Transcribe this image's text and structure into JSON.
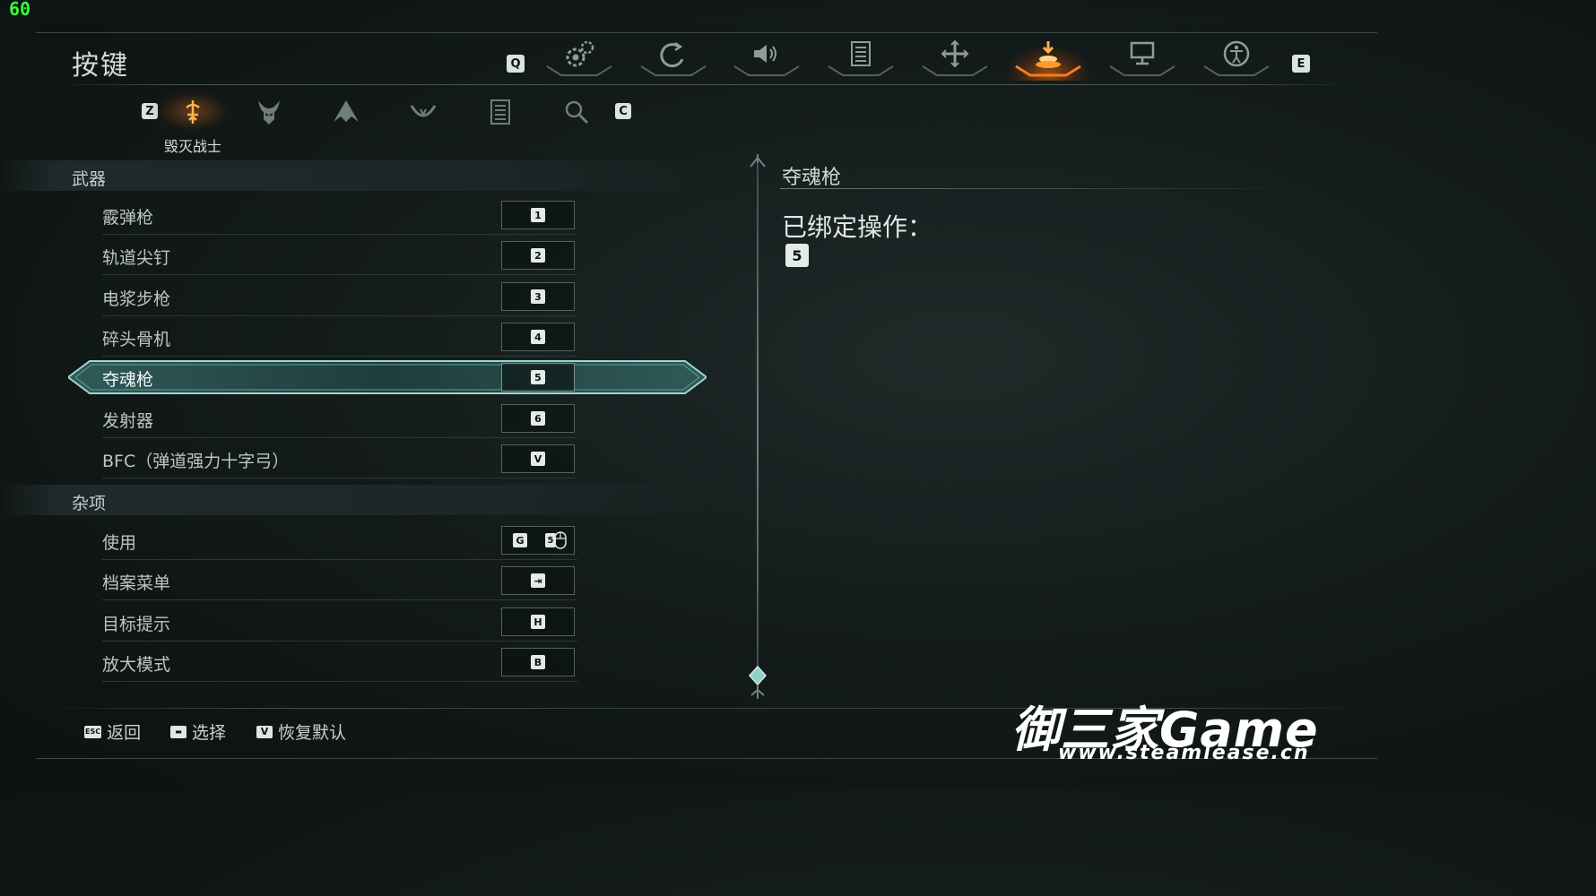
{
  "fps": "60",
  "page_title": "按键",
  "top_nav": {
    "left_key": "Q",
    "right_key": "E",
    "tabs": [
      {
        "icon": "gear-icon",
        "active": false
      },
      {
        "icon": "spiral-icon",
        "active": false
      },
      {
        "icon": "speaker-icon",
        "active": false
      },
      {
        "icon": "list-icon",
        "active": false
      },
      {
        "icon": "cross-arrows-icon",
        "active": false
      },
      {
        "icon": "keybind-icon",
        "active": true
      },
      {
        "icon": "monitor-icon",
        "active": false
      },
      {
        "icon": "accessibility-icon",
        "active": false
      }
    ],
    "active_color": "#ff7a18"
  },
  "sub_nav": {
    "left_key": "Z",
    "right_key": "C",
    "active_label": "毁灭战士",
    "tabs": [
      {
        "icon": "slayer-rune-icon",
        "active": true
      },
      {
        "icon": "demon-helmet-icon",
        "active": false
      },
      {
        "icon": "wing-creature-icon",
        "active": false
      },
      {
        "icon": "bowl-emblem-icon",
        "active": false
      },
      {
        "icon": "list-icon",
        "active": false
      },
      {
        "icon": "magnifier-icon",
        "active": false
      }
    ]
  },
  "sections": [
    {
      "title": "武器",
      "rows": [
        {
          "label": "霰弹枪",
          "keys": [
            "1"
          ]
        },
        {
          "label": "轨道尖钉",
          "keys": [
            "2"
          ]
        },
        {
          "label": "电浆步枪",
          "keys": [
            "3"
          ]
        },
        {
          "label": "碎头骨机",
          "keys": [
            "4"
          ]
        },
        {
          "label": "夺魂枪",
          "keys": [
            "5"
          ],
          "selected": true
        },
        {
          "label": "发射器",
          "keys": [
            "6"
          ]
        },
        {
          "label": "BFC（弹道强力十字弓）",
          "keys": [
            "V"
          ]
        }
      ]
    },
    {
      "title": "杂项",
      "rows": [
        {
          "label": "使用",
          "keys": [
            "G",
            "5"
          ]
        },
        {
          "label": "档案菜单",
          "keys": [
            "⇥"
          ]
        },
        {
          "label": "目标提示",
          "keys": [
            "H"
          ]
        },
        {
          "label": "放大模式",
          "keys": [
            "B"
          ]
        }
      ]
    }
  ],
  "detail": {
    "title": "夺魂枪",
    "subtitle": "已绑定操作：",
    "key": "5"
  },
  "footer": [
    {
      "key": "ESC",
      "label": "返回"
    },
    {
      "key": "▬",
      "label": "选择"
    },
    {
      "key": "V",
      "label": "恢复默认"
    }
  ],
  "watermark": {
    "main": "御三家Game",
    "url": "www.steamlease.cn"
  }
}
